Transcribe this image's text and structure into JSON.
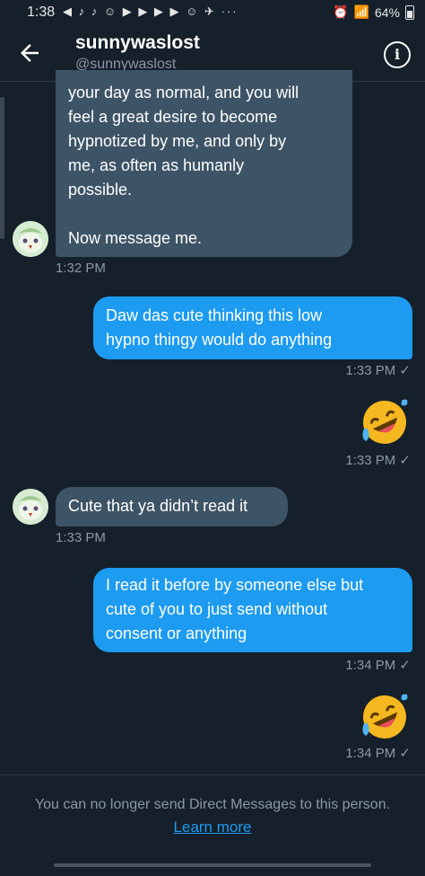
{
  "status_bar": {
    "time": "1:38",
    "battery": "64%",
    "app_icons": "◀ ♪ ♪ ☺ ▶ ▶ ▶ ▶ ☺ ✈  ···"
  },
  "header": {
    "name": "sunnywaslost",
    "handle": "@sunnywaslost_"
  },
  "messages": [
    {
      "from": "them",
      "text": "your day as normal, and you will\nfeel a great desire to become\nhypnotized by me, and only by\nme, as often as humanly\npossible.\n\nNow message me.",
      "time": "1:32 PM"
    },
    {
      "from": "me",
      "text": "Daw das cute thinking this low\nhypno thingy would do anything",
      "time": "1:33 PM ✓"
    },
    {
      "from": "me",
      "emoji": "rofl-emoji",
      "time": "1:33 PM ✓"
    },
    {
      "from": "them",
      "text": "Cute that ya didn’t read it",
      "time": "1:33 PM"
    },
    {
      "from": "me",
      "text": "I read it before by someone else but\ncute of you to just send without\nconsent or anything",
      "time": "1:34 PM ✓"
    },
    {
      "from": "me",
      "emoji": "rofl-emoji",
      "time": "1:34 PM ✓"
    }
  ],
  "footer": {
    "notice": "You can no longer send Direct Messages to this person.",
    "link": "Learn more"
  },
  "colors": {
    "background": "#15202b",
    "incoming_bubble": "#3d5466",
    "outgoing_bubble": "#1d9bf0",
    "muted": "#8b98a5"
  }
}
